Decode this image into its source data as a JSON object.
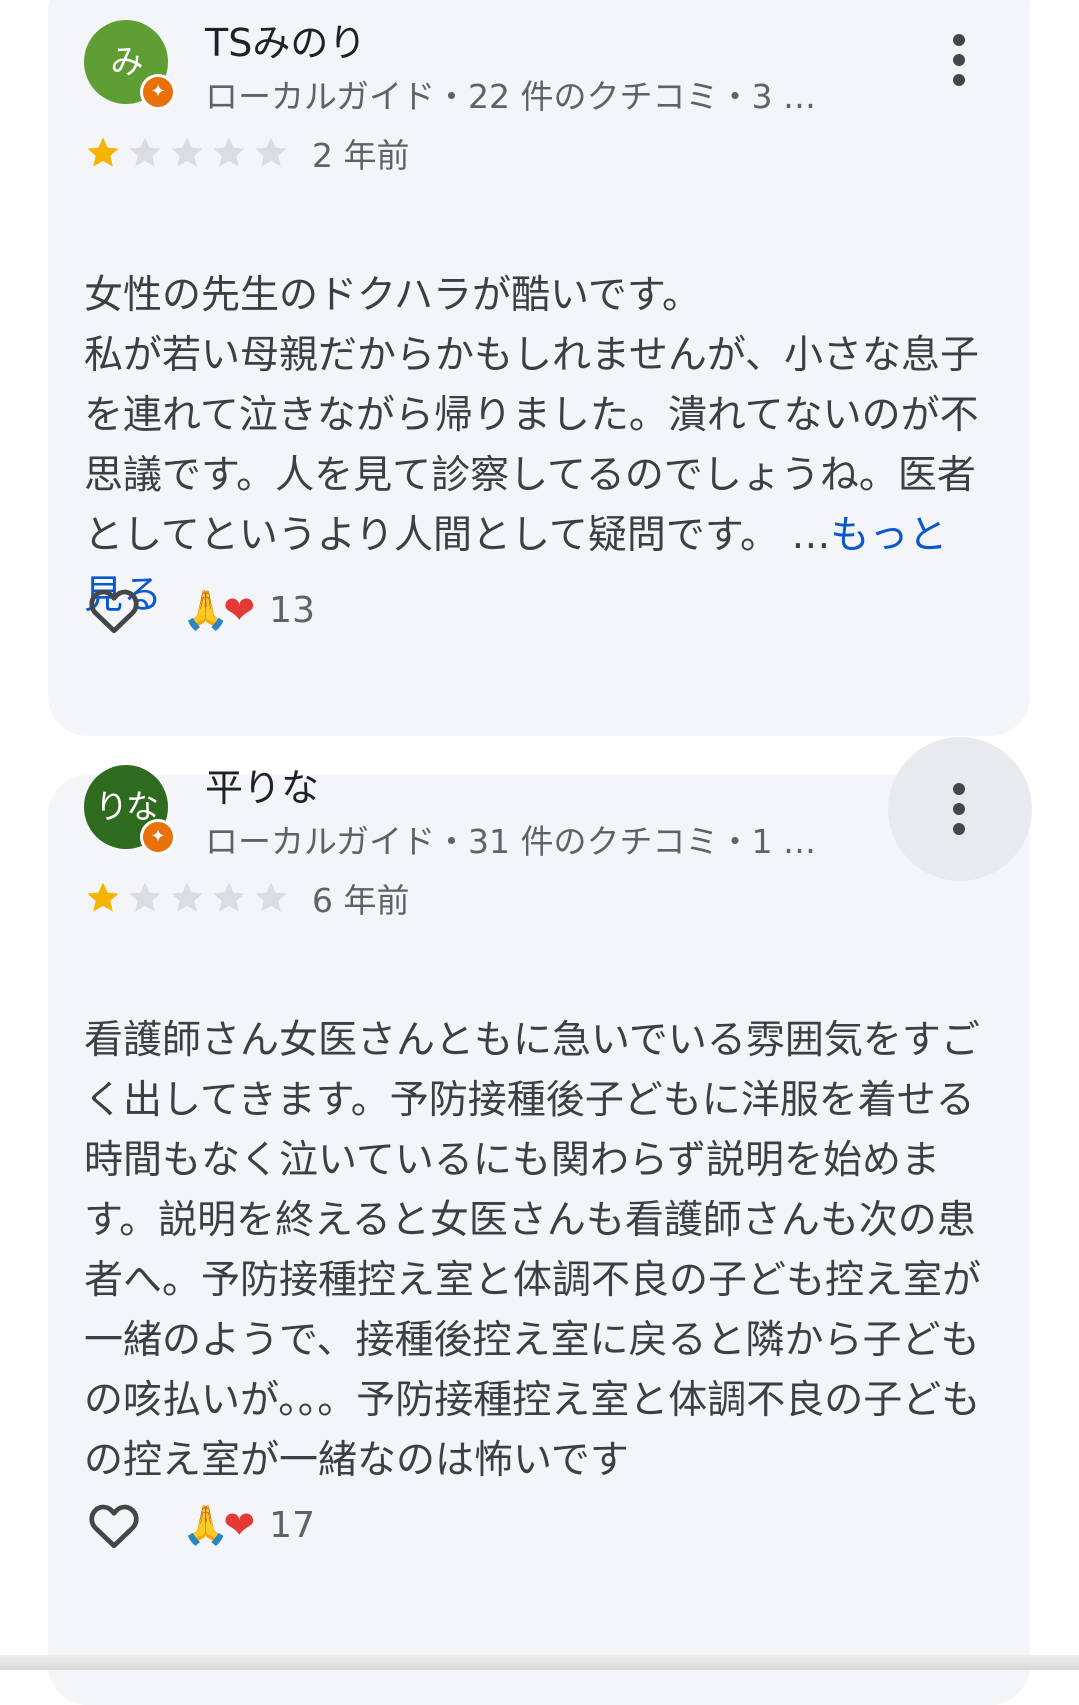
{
  "reviews": [
    {
      "avatar_text": "み",
      "avatar_color": "#5e9e33",
      "author": "TSみのり",
      "meta": "ローカルガイド・22 件のクチコミ・3 …",
      "rating": 1,
      "max_rating": 5,
      "time": "2 年前",
      "text": "女性の先生のドクハラが酷いです。\n私が若い母親だからかもしれませんが、小さな息子を連れて泣きながら帰りました。潰れてないのが不思議です。人を見て診察してるのでしょうね。医者としてというより人間として疑問です。 …",
      "see_more": "もっと見る",
      "reaction_count": "13",
      "reaction_icons": [
        "folded-hands-emoji",
        "red-heart-emoji"
      ]
    },
    {
      "avatar_text": "りな",
      "avatar_color": "#2e6b1f",
      "author": "平りな",
      "meta": "ローカルガイド・31 件のクチコミ・1 …",
      "rating": 1,
      "max_rating": 5,
      "time": "6 年前",
      "text": "看護師さん女医さんともに急いでいる雰囲気をすごく出してきます。予防接種後子どもに洋服を着せる時間もなく泣いているにも関わらず説明を始めます。説明を終えると女医さんも看護師さんも次の患者へ。予防接種控え室と体調不良の子ども控え室が一緒のようで、接種後控え室に戻ると隣から子どもの咳払いが。。。予防接種控え室と体調不良の子どもの控え室が一緒なのは怖いです",
      "reaction_count": "17",
      "reaction_icons": [
        "folded-hands-emoji",
        "red-heart-emoji"
      ]
    }
  ],
  "colors": {
    "star_filled": "#f5b400",
    "star_empty": "#dadce0",
    "link": "#0b57d0",
    "badge": "#e8710a",
    "card_bg": "#f3f5f8"
  }
}
